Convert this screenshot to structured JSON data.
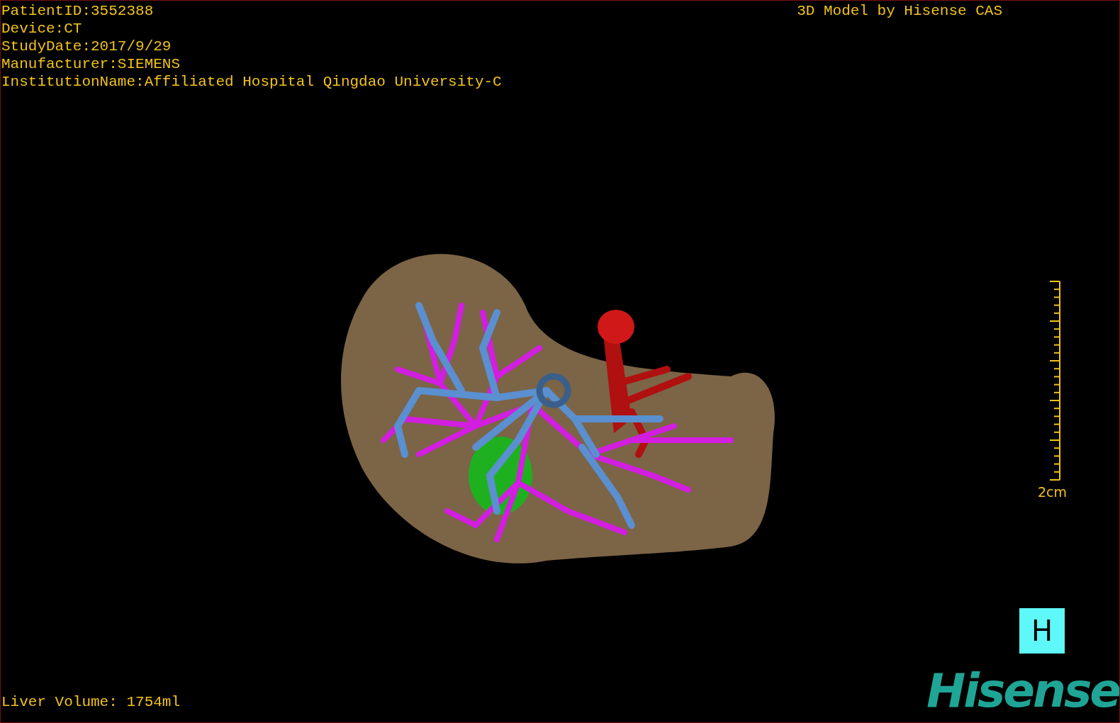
{
  "patient_info": [
    "PatientID:3552388",
    "Device:CT",
    "StudyDate:2017/9/29",
    "Manufacturer:SIEMENS",
    "InstitutionName:Affiliated Hospital Qingdao University-C"
  ],
  "model_credit": "3D Model by Hisense CAS",
  "scale_bar": {
    "label": "2cm"
  },
  "view_button": {
    "label": "H"
  },
  "logo": "Hisense",
  "liver_volume": "Liver Volume: 1754ml"
}
